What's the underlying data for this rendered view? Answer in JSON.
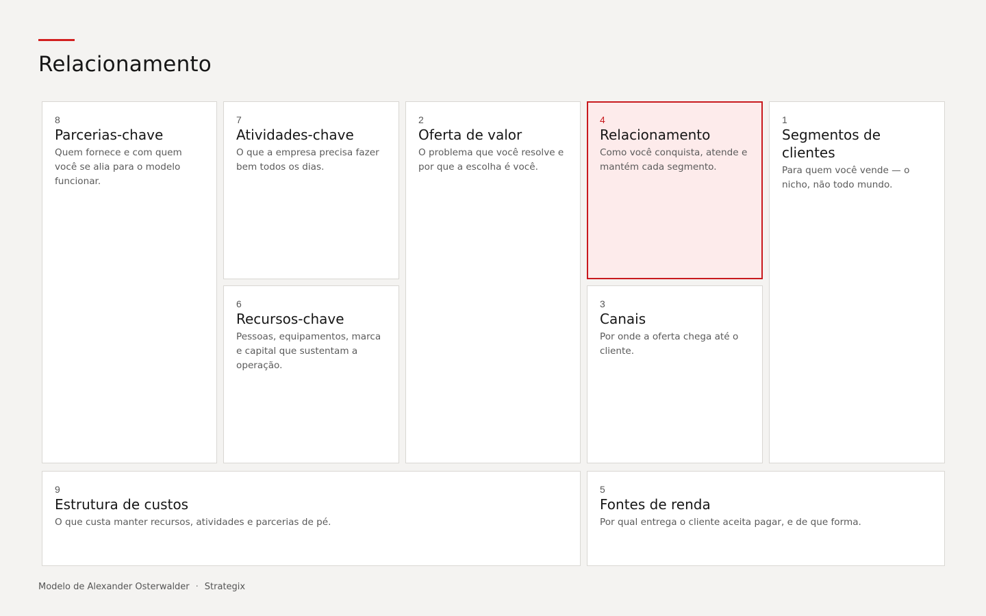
{
  "header": {
    "title": "Relacionamento",
    "accent_color": "#d21f1f"
  },
  "canvas": {
    "active_block": "4",
    "blocks": {
      "parcerias": {
        "number": "8",
        "title": "Parcerias-chave",
        "description": "Quem fornece e com quem você se alia para o modelo funcionar."
      },
      "atividades": {
        "number": "7",
        "title": "Atividades-chave",
        "description": "O que a empresa precisa fazer bem todos os dias."
      },
      "recursos": {
        "number": "6",
        "title": "Recursos-chave",
        "description": "Pessoas, equipamentos, marca e capital que sustentam a operação."
      },
      "oferta": {
        "number": "2",
        "title": "Oferta de valor",
        "description": "O problema que você resolve e por que a escolha é você."
      },
      "relacionamento": {
        "number": "4",
        "title": "Relacionamento",
        "description": "Como você conquista, atende e mantém cada segmento."
      },
      "canais": {
        "number": "3",
        "title": "Canais",
        "description": "Por onde a oferta chega até o cliente."
      },
      "segmentos": {
        "number": "1",
        "title": "Segmentos de clientes",
        "description": "Para quem você vende — o nicho, não todo mundo."
      },
      "custos": {
        "number": "9",
        "title": "Estrutura de custos",
        "description": "O que custa manter recursos, atividades e parcerias de pé."
      },
      "renda": {
        "number": "5",
        "title": "Fontes de renda",
        "description": "Por qual entrega o cliente aceita pagar, e de que forma."
      }
    }
  },
  "footer": {
    "credit": "Modelo de Alexander Osterwalder",
    "separator": "·",
    "brand": "Strategix"
  }
}
